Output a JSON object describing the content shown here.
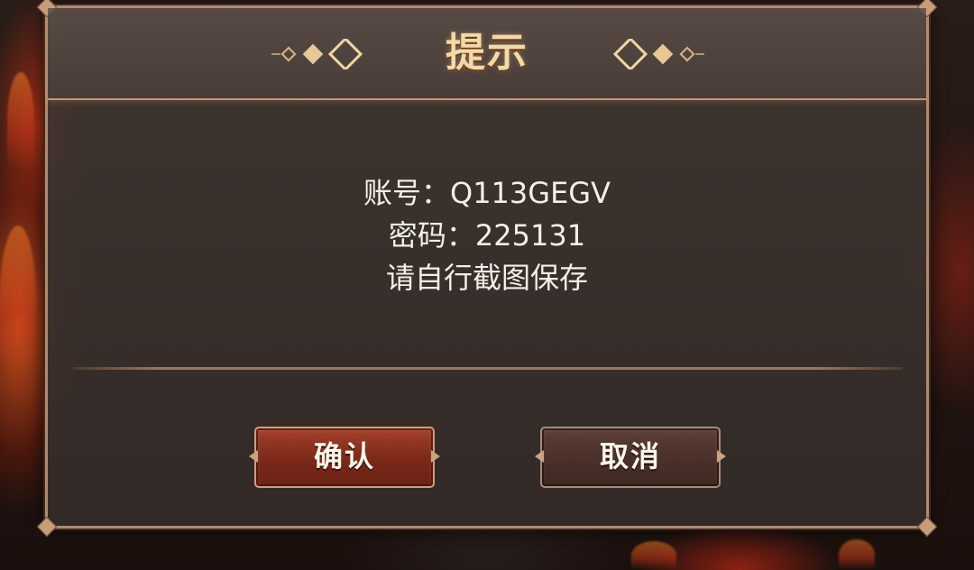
{
  "dialog": {
    "title": "提示",
    "lines": [
      "账号：Q113GEGV",
      "密码：225131",
      "请自行截图保存"
    ],
    "confirm_label": "确认",
    "cancel_label": "取消"
  },
  "colors": {
    "title_gold": "#f3d9a8",
    "frame_border": "#b3896a",
    "confirm_red": "#7a2819",
    "cancel_brown": "#4a302a",
    "body_text": "#f2efe9"
  },
  "icons": {
    "title_ornament_left": "diamond-ornament-icon",
    "title_ornament_right": "diamond-ornament-icon"
  }
}
